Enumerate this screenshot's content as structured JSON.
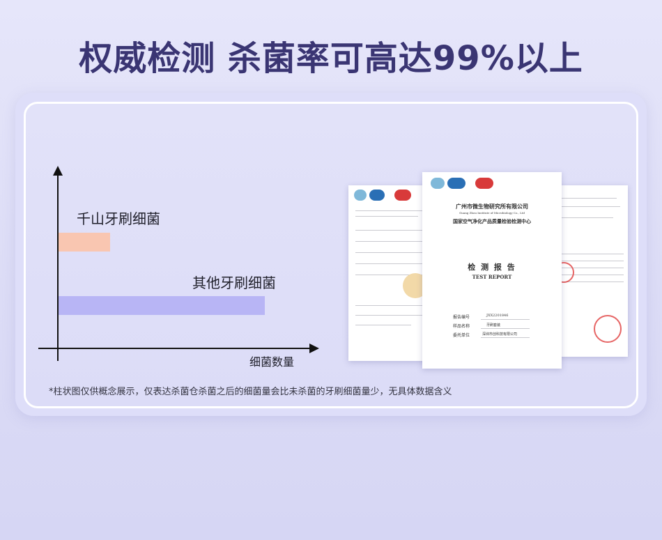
{
  "headline": "权威检测 杀菌率可高达99%以上",
  "chart_data": {
    "type": "bar",
    "orientation": "horizontal",
    "categories": [
      "千山牙刷细菌",
      "其他牙刷细菌"
    ],
    "values": [
      25,
      100
    ],
    "xlabel": "细菌数量",
    "ylabel": "",
    "xlim": [
      0,
      125
    ],
    "bar_colors": [
      "#f9c6b1",
      "#b8b5f5"
    ],
    "grid": false
  },
  "footnote": "*柱状图仅供概念展示，仅表达杀菌仓杀菌之后的细菌量会比未杀菌的牙刷细菌量少，无具体数据含义",
  "report": {
    "org_name": "广州市微生物研究所有限公司",
    "org_name_en": "Guang Zhou Institute of Microbiology Co., Ltd",
    "center_name": "国家空气净化产品质量检验检测中心",
    "title": "检 测 报 告",
    "title_en": "TEST  REPORT",
    "fields": [
      {
        "label": "报告编号",
        "value": "JXX2201846"
      },
      {
        "label": "样品名称",
        "value": "牙刷套装"
      },
      {
        "label": "委托单位",
        "value": "深圳市创科技有限公司"
      }
    ],
    "logos": [
      "ILAC-MRA",
      "CNAS",
      "MA"
    ]
  },
  "colors": {
    "headline": "#3a3573",
    "axis": "#111111",
    "bar_qianshan": "#f9c6b1",
    "bar_other": "#b8b5f5"
  }
}
